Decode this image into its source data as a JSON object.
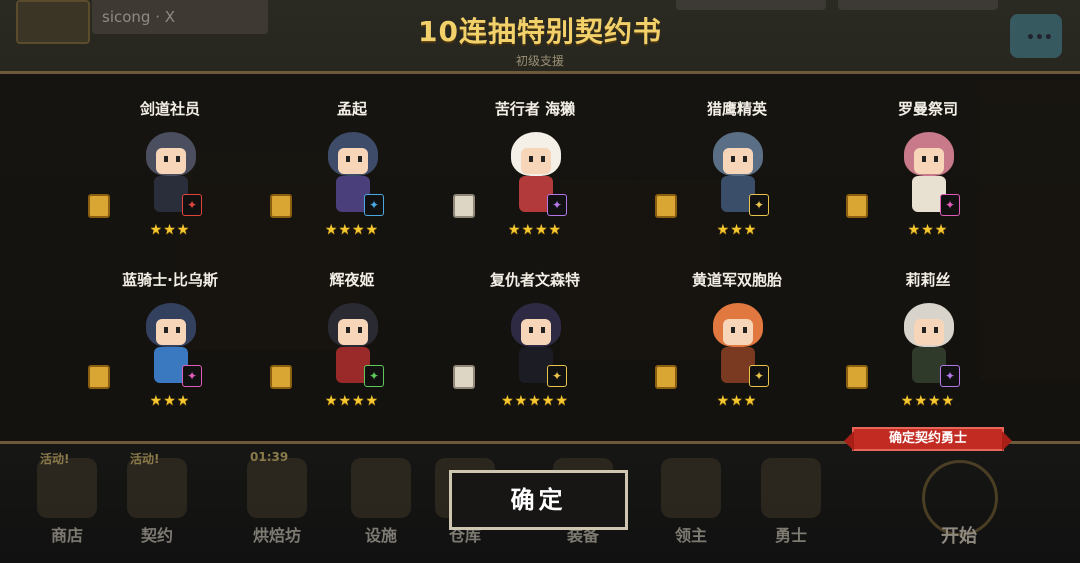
{
  "header": {
    "username": "sicong · X",
    "title": "10连抽特别契约书",
    "subtitle": "初级支援"
  },
  "cards": [
    {
      "name": "剑道社员",
      "stars": "★★★",
      "scroll": "gold",
      "weapon_color": "#e0443a"
    },
    {
      "name": "孟起",
      "stars": "★★★★",
      "scroll": "gold",
      "weapon_color": "#49a8e0"
    },
    {
      "name": "苦行者 海獭",
      "stars": "★★★★",
      "scroll": "white",
      "weapon_color": "#b477e8"
    },
    {
      "name": "猎鹰精英",
      "stars": "★★★",
      "scroll": "gold",
      "weapon_color": "#e8c44a"
    },
    {
      "name": "罗曼祭司",
      "stars": "★★★",
      "scroll": "gold",
      "weapon_color": "#e05cb8"
    },
    {
      "name": "蓝骑士·比乌斯",
      "stars": "★★★",
      "scroll": "gold",
      "weapon_color": "#e05cb8"
    },
    {
      "name": "辉夜姬",
      "stars": "★★★★",
      "scroll": "gold",
      "weapon_color": "#5ec85a"
    },
    {
      "name": "复仇者文森特",
      "stars": "★★★★★",
      "scroll": "white",
      "weapon_color": "#e8c44a"
    },
    {
      "name": "黄道军双胞胎",
      "stars": "★★★",
      "scroll": "gold",
      "weapon_color": "#e8c44a"
    },
    {
      "name": "莉莉丝",
      "stars": "★★★★",
      "scroll": "gold",
      "weapon_color": "#b477e8"
    }
  ],
  "ribbon_label": "确定契约勇士",
  "confirm_label": "确定",
  "nav": [
    {
      "label": "商店",
      "tag": "活动!"
    },
    {
      "label": "契约",
      "tag": "活动!"
    },
    {
      "label": "烘焙坊",
      "tag": "01:39"
    },
    {
      "label": "设施",
      "tag": ""
    },
    {
      "label": "仓库",
      "tag": ""
    },
    {
      "label": "装备",
      "tag": ""
    },
    {
      "label": "领主",
      "tag": ""
    },
    {
      "label": "勇士",
      "tag": ""
    }
  ],
  "start_label": "开始",
  "colors": {
    "title": "#f2d16b",
    "star": "#f5c830",
    "ribbon": "#c22b22"
  }
}
